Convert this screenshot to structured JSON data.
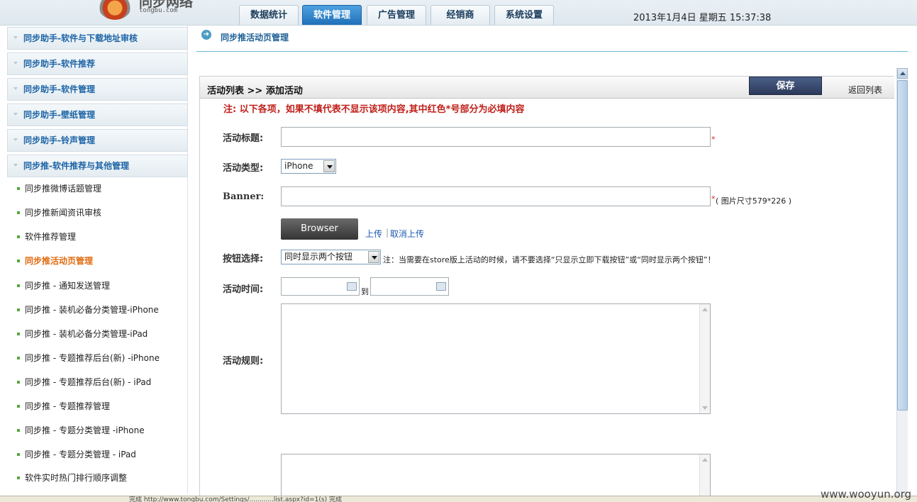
{
  "header": {
    "logo_title": "同步网络",
    "logo_domain": "tongbu.com",
    "tabs": [
      {
        "label": "数据统计",
        "active": false
      },
      {
        "label": "软件管理",
        "active": true
      },
      {
        "label": "广告管理",
        "active": false
      },
      {
        "label": "经销商",
        "active": false
      },
      {
        "label": "系统设置",
        "active": false
      }
    ],
    "datetime": "2013年1月4日  星期五  15:37:38"
  },
  "sidebar": {
    "categories": [
      {
        "label": "同步助手-软件与下载地址审核"
      },
      {
        "label": "同步助手-软件推荐"
      },
      {
        "label": "同步助手-软件管理"
      },
      {
        "label": "同步助手-壁纸管理"
      },
      {
        "label": "同步助手-铃声管理"
      },
      {
        "label": "同步推-软件推荐与其他管理"
      }
    ],
    "items": [
      {
        "label": "同步推微博话题管理",
        "active": false
      },
      {
        "label": "同步推新闻资讯审核",
        "active": false
      },
      {
        "label": "软件推荐管理",
        "active": false
      },
      {
        "label": "同步推活动页管理",
        "active": true
      },
      {
        "label": "同步推 - 通知发送管理",
        "active": false
      },
      {
        "label": "同步推 - 装机必备分类管理-iPhone",
        "active": false
      },
      {
        "label": "同步推 - 装机必备分类管理-iPad",
        "active": false
      },
      {
        "label": "同步推 - 专题推荐后台(新) -iPhone",
        "active": false
      },
      {
        "label": "同步推 - 专题推荐后台(新) - iPad",
        "active": false
      },
      {
        "label": "同步推 - 专题推荐管理",
        "active": false
      },
      {
        "label": "同步推 - 专题分类管理  -iPhone",
        "active": false
      },
      {
        "label": "同步推 - 专题分类管理  - iPad",
        "active": false
      },
      {
        "label": "软件实时热门排行顺序调整",
        "active": false
      }
    ]
  },
  "main": {
    "page_title": "同步推活动页管理",
    "panel_breadcrumb": "活动列表  >> 添加活动",
    "save_label": "保存",
    "back_label": "返回列表",
    "notice": "注: 以下各项，如果不填代表不显示该项内容,其中红色*号部分为必填内容",
    "form": {
      "title_label": "活动标题:",
      "title_value": "",
      "type_label": "活动类型:",
      "type_selected": "iPhone",
      "banner_label": "Banner:",
      "banner_value": "",
      "banner_hint": "( 图片尺寸579*226 )",
      "browse_label": "Browser",
      "upload_link": "上传",
      "cancel_upload_link": "取消上传",
      "button_choice_label": "按钮选择:",
      "button_choice_selected": "同时显示两个按钮",
      "button_choice_note": "注：当需要在store版上活动的时候，请不要选择“只显示立即下载按钮”或“同时显示两个按钮”！",
      "time_label": "活动时间:",
      "time_start": "",
      "time_to": "到",
      "time_end": "",
      "rules_label": "活动规则:",
      "rules_value": "",
      "required_mark": "*"
    }
  },
  "statusbar": {
    "url_text": "完成    http://www.tongbu.com/Settings/............list.aspx?id=1(s)    完成"
  },
  "watermark": "www.wooyun.org",
  "colors": {
    "accent": "#1f6fb8",
    "sidebar_category_text": "#1d64a6",
    "active_item": "#e06a10",
    "notice_red": "#c0201a",
    "save_button": "#2c3a5c"
  },
  "icons": [
    "logo-icon",
    "arrow-right-icon",
    "calendar-icon",
    "chevron-down-icon",
    "bullet-icon"
  ]
}
